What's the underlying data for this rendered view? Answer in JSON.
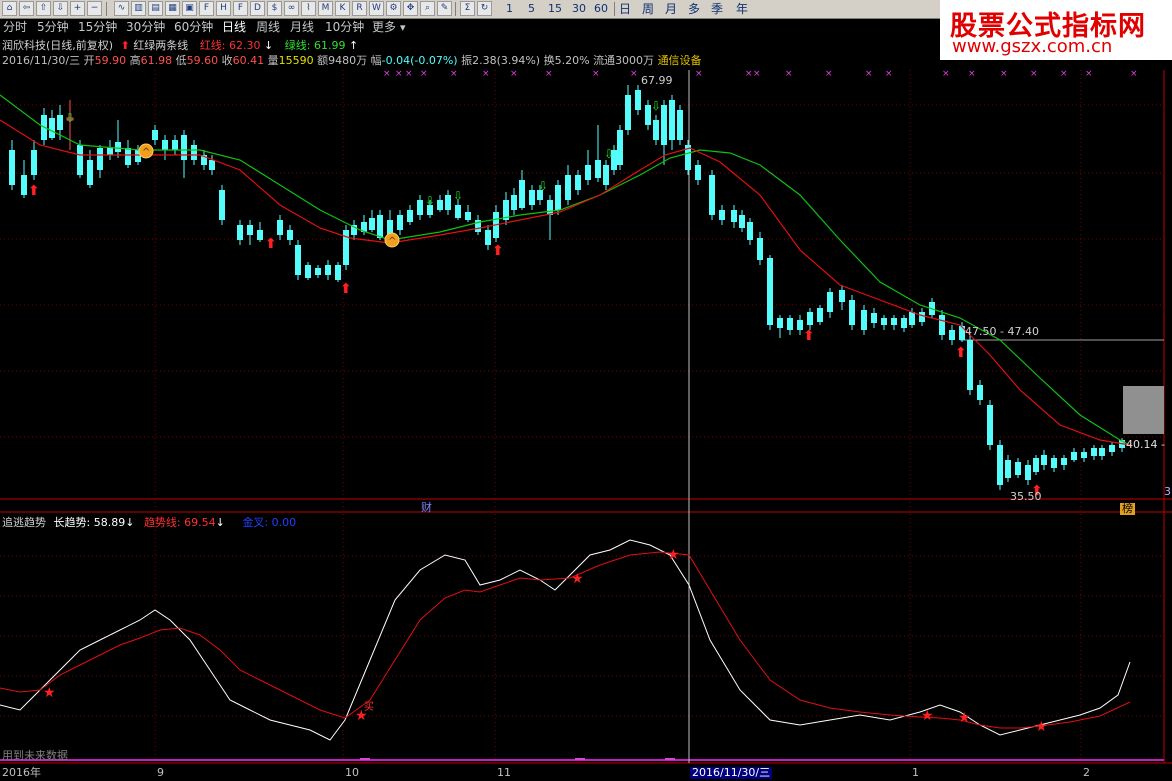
{
  "toolbar": {
    "numbers": [
      "1",
      "5",
      "15",
      "30",
      "60"
    ],
    "cn": [
      "日",
      "周",
      "月",
      "多",
      "季",
      "年"
    ]
  },
  "periods": [
    "分时",
    "5分钟",
    "15分钟",
    "30分钟",
    "60分钟",
    "日线",
    "周线",
    "月线",
    "10分钟",
    "更多"
  ],
  "active_period": "日线",
  "more_arrow": "▾",
  "watermark": {
    "title": "股票公式指标网",
    "url": "www.gszx.com.cn"
  },
  "stock": {
    "title": "润欣科技(日线,前复权)",
    "indicator_name": "红绿两条线",
    "red_label": "红线:",
    "red_value": "62.30",
    "red_arrow": "↓",
    "green_label": "绿线:",
    "green_value": "61.99",
    "green_arrow": "↑"
  },
  "quote": {
    "date": "2016/11/30/三",
    "open_label": "开",
    "open": "59.90",
    "high_label": "高",
    "high": "61.98",
    "low_label": "低",
    "low": "59.60",
    "close_label": "收",
    "close": "60.41",
    "vol_label": "量",
    "vol": "15590",
    "amount_label": "额",
    "amount": "9480万",
    "change_label": "幅",
    "change": "-0.04(-0.07%)",
    "amp_label": "振",
    "amp": "2.38(3.94%)",
    "turnover_label": "换",
    "turnover": "5.20%",
    "float_label": "流通",
    "float": "3000万",
    "industry": "通信设备"
  },
  "price_labels": {
    "high_mark": "67.99",
    "level": "47.50 - 47.40",
    "right_value": "40.14 -",
    "low_mark": "35.50",
    "fin_marker": "财",
    "right_corner": "3",
    "bang_marker": "榜"
  },
  "sub_indicator": {
    "name": "追逃趋势",
    "long_label": "长趋势:",
    "long_value": "58.89",
    "long_arrow": "↓",
    "trend_label": "趋势线:",
    "trend_value": "69.54",
    "trend_arrow": "↓",
    "gold_label": "金叉:",
    "gold_value": "0.00",
    "future_note": "用到未来数据",
    "buy_mark": "买"
  },
  "time_axis": {
    "labels": [
      "2016年",
      "9",
      "10",
      "11",
      "2016/11/30/三",
      "1",
      "2"
    ]
  },
  "colors": {
    "background": "#000000",
    "up_candle": "#ff5050",
    "down_candle": "#54fcfc",
    "red_line": "#e01010",
    "green_line": "#10c010",
    "white_line": "#ffffff",
    "grid": "#800000",
    "crosshair": "#c0c0c0"
  }
}
